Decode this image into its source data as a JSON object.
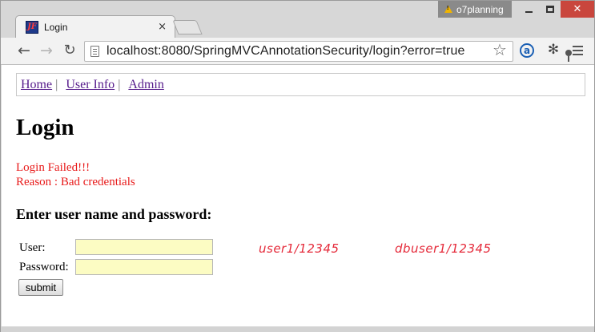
{
  "browser": {
    "profile_name": "o7planning",
    "tab_title": "Login",
    "tab_close": "×",
    "url": "localhost:8080/SpringMVCAnnotationSecurity/login?error=true",
    "close_glyph": "✕",
    "favicon_text": "JF",
    "nav_back": "←",
    "nav_forward": "→",
    "nav_reload": "↻",
    "star": "☆",
    "ext_a": "a",
    "ext_bug": "✻"
  },
  "menu": {
    "items": [
      "Home",
      "User Info",
      "Admin"
    ],
    "separator": "|"
  },
  "page": {
    "heading": "Login",
    "error_line1": "Login Failed!!!",
    "error_line2": "Reason : Bad credentials",
    "subheading": "Enter user name and password:",
    "user_label": "User:",
    "password_label": "Password:",
    "user_value": "",
    "password_value": "",
    "submit_label": "submit"
  },
  "annotations": {
    "note_1": "user1/12345",
    "note_2": "dbuser1/12345"
  },
  "colors": {
    "error": "#e81a1a",
    "input_bg": "#fcfcc3",
    "link": "#551a8b",
    "close_btn": "#c9463d"
  }
}
